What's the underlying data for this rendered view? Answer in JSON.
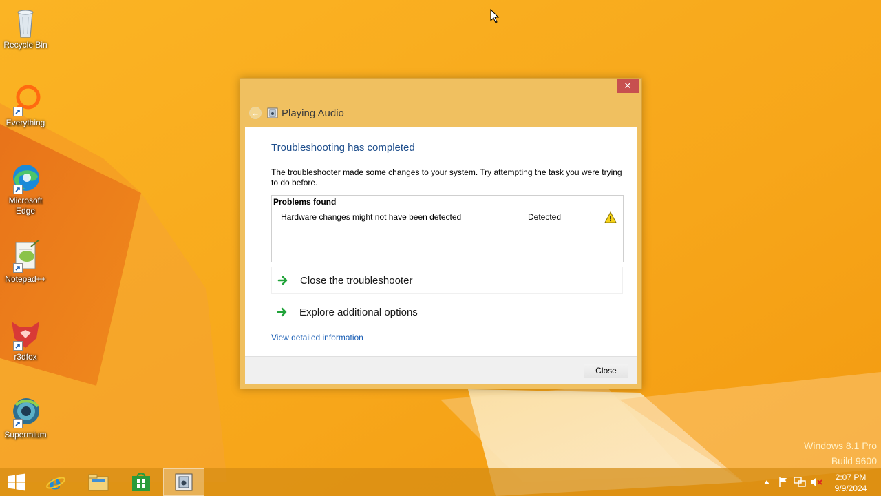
{
  "desktop": {
    "icons": [
      {
        "label": "Recycle Bin"
      },
      {
        "label": "Everything"
      },
      {
        "label": "Microsoft Edge"
      },
      {
        "label": "Notepad++"
      },
      {
        "label": "r3dfox"
      },
      {
        "label": "Supermium"
      }
    ],
    "watermark": {
      "line1": "Windows 8.1 Pro",
      "line2": "Build 9600"
    }
  },
  "window": {
    "title": "Playing Audio",
    "close_glyph": "✕",
    "back_glyph": "←",
    "heading": "Troubleshooting has completed",
    "description": "The troubleshooter made some changes to your system. Try attempting the task you were trying to do before.",
    "problems": {
      "title": "Problems found",
      "rows": [
        {
          "text": "Hardware changes might not have been detected",
          "status": "Detected",
          "icon": "warning-icon"
        }
      ]
    },
    "options": [
      {
        "label": "Close the troubleshooter",
        "icon": "green-arrow-icon"
      },
      {
        "label": "Explore additional options",
        "icon": "green-arrow-icon"
      }
    ],
    "detail_link": "View detailed information",
    "close_button": "Close"
  },
  "taskbar": {
    "buttons": [
      "start-button",
      "internet-explorer",
      "file-explorer",
      "store",
      "troubleshooter"
    ],
    "clock": {
      "time": "2:07 PM",
      "date": "9/9/2024"
    }
  },
  "colors": {
    "wallpaper": "#f7a81c",
    "window_frame": "#f0c060",
    "heading": "#1e4e8c",
    "link": "#1b5fb5",
    "close_red": "#c7504f"
  }
}
